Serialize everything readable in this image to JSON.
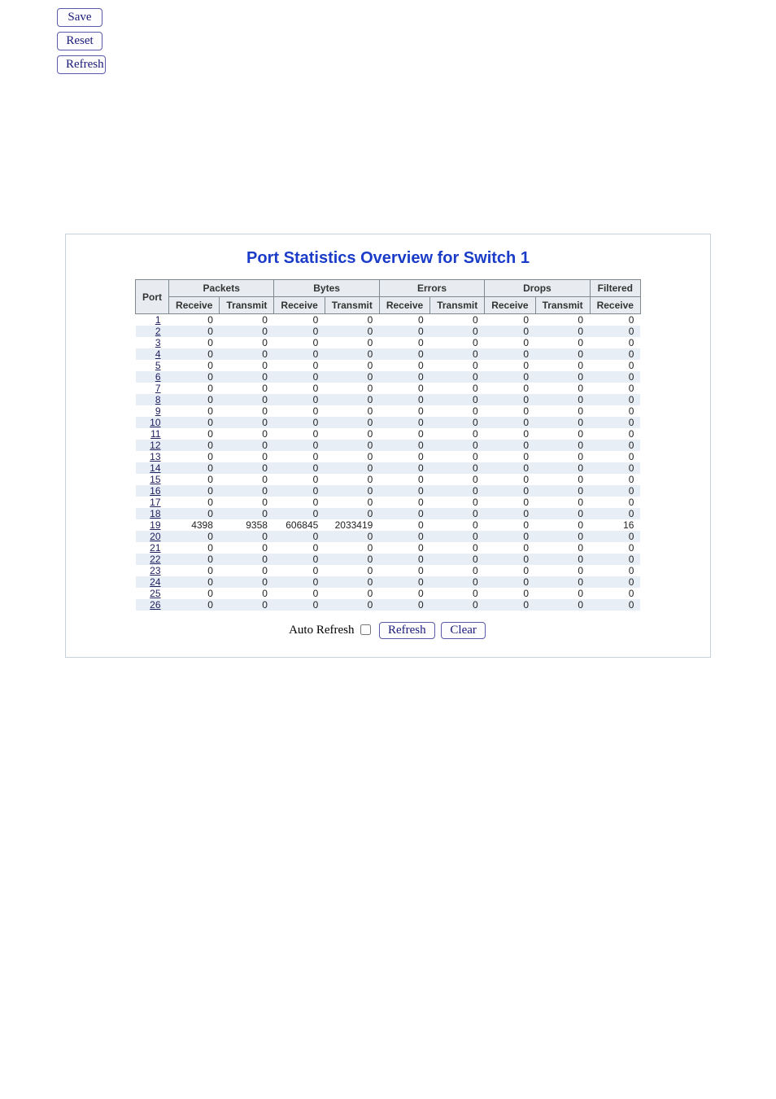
{
  "top_buttons": {
    "save": "Save",
    "reset": "Reset",
    "refresh": "Refresh"
  },
  "panel": {
    "title": "Port Statistics Overview for Switch 1"
  },
  "headers": {
    "port": "Port",
    "groups": [
      "Packets",
      "Bytes",
      "Errors",
      "Drops",
      "Filtered"
    ],
    "sub_rx": "Receive",
    "sub_tx": "Transmit"
  },
  "rows": [
    {
      "port": "1",
      "pkts_rx": "0",
      "pkts_tx": "0",
      "bytes_rx": "0",
      "bytes_tx": "0",
      "err_rx": "0",
      "err_tx": "0",
      "drop_rx": "0",
      "drop_tx": "0",
      "filt_rx": "0"
    },
    {
      "port": "2",
      "pkts_rx": "0",
      "pkts_tx": "0",
      "bytes_rx": "0",
      "bytes_tx": "0",
      "err_rx": "0",
      "err_tx": "0",
      "drop_rx": "0",
      "drop_tx": "0",
      "filt_rx": "0"
    },
    {
      "port": "3",
      "pkts_rx": "0",
      "pkts_tx": "0",
      "bytes_rx": "0",
      "bytes_tx": "0",
      "err_rx": "0",
      "err_tx": "0",
      "drop_rx": "0",
      "drop_tx": "0",
      "filt_rx": "0"
    },
    {
      "port": "4",
      "pkts_rx": "0",
      "pkts_tx": "0",
      "bytes_rx": "0",
      "bytes_tx": "0",
      "err_rx": "0",
      "err_tx": "0",
      "drop_rx": "0",
      "drop_tx": "0",
      "filt_rx": "0"
    },
    {
      "port": "5",
      "pkts_rx": "0",
      "pkts_tx": "0",
      "bytes_rx": "0",
      "bytes_tx": "0",
      "err_rx": "0",
      "err_tx": "0",
      "drop_rx": "0",
      "drop_tx": "0",
      "filt_rx": "0"
    },
    {
      "port": "6",
      "pkts_rx": "0",
      "pkts_tx": "0",
      "bytes_rx": "0",
      "bytes_tx": "0",
      "err_rx": "0",
      "err_tx": "0",
      "drop_rx": "0",
      "drop_tx": "0",
      "filt_rx": "0"
    },
    {
      "port": "7",
      "pkts_rx": "0",
      "pkts_tx": "0",
      "bytes_rx": "0",
      "bytes_tx": "0",
      "err_rx": "0",
      "err_tx": "0",
      "drop_rx": "0",
      "drop_tx": "0",
      "filt_rx": "0"
    },
    {
      "port": "8",
      "pkts_rx": "0",
      "pkts_tx": "0",
      "bytes_rx": "0",
      "bytes_tx": "0",
      "err_rx": "0",
      "err_tx": "0",
      "drop_rx": "0",
      "drop_tx": "0",
      "filt_rx": "0"
    },
    {
      "port": "9",
      "pkts_rx": "0",
      "pkts_tx": "0",
      "bytes_rx": "0",
      "bytes_tx": "0",
      "err_rx": "0",
      "err_tx": "0",
      "drop_rx": "0",
      "drop_tx": "0",
      "filt_rx": "0"
    },
    {
      "port": "10",
      "pkts_rx": "0",
      "pkts_tx": "0",
      "bytes_rx": "0",
      "bytes_tx": "0",
      "err_rx": "0",
      "err_tx": "0",
      "drop_rx": "0",
      "drop_tx": "0",
      "filt_rx": "0"
    },
    {
      "port": "11",
      "pkts_rx": "0",
      "pkts_tx": "0",
      "bytes_rx": "0",
      "bytes_tx": "0",
      "err_rx": "0",
      "err_tx": "0",
      "drop_rx": "0",
      "drop_tx": "0",
      "filt_rx": "0"
    },
    {
      "port": "12",
      "pkts_rx": "0",
      "pkts_tx": "0",
      "bytes_rx": "0",
      "bytes_tx": "0",
      "err_rx": "0",
      "err_tx": "0",
      "drop_rx": "0",
      "drop_tx": "0",
      "filt_rx": "0"
    },
    {
      "port": "13",
      "pkts_rx": "0",
      "pkts_tx": "0",
      "bytes_rx": "0",
      "bytes_tx": "0",
      "err_rx": "0",
      "err_tx": "0",
      "drop_rx": "0",
      "drop_tx": "0",
      "filt_rx": "0"
    },
    {
      "port": "14",
      "pkts_rx": "0",
      "pkts_tx": "0",
      "bytes_rx": "0",
      "bytes_tx": "0",
      "err_rx": "0",
      "err_tx": "0",
      "drop_rx": "0",
      "drop_tx": "0",
      "filt_rx": "0"
    },
    {
      "port": "15",
      "pkts_rx": "0",
      "pkts_tx": "0",
      "bytes_rx": "0",
      "bytes_tx": "0",
      "err_rx": "0",
      "err_tx": "0",
      "drop_rx": "0",
      "drop_tx": "0",
      "filt_rx": "0"
    },
    {
      "port": "16",
      "pkts_rx": "0",
      "pkts_tx": "0",
      "bytes_rx": "0",
      "bytes_tx": "0",
      "err_rx": "0",
      "err_tx": "0",
      "drop_rx": "0",
      "drop_tx": "0",
      "filt_rx": "0"
    },
    {
      "port": "17",
      "pkts_rx": "0",
      "pkts_tx": "0",
      "bytes_rx": "0",
      "bytes_tx": "0",
      "err_rx": "0",
      "err_tx": "0",
      "drop_rx": "0",
      "drop_tx": "0",
      "filt_rx": "0"
    },
    {
      "port": "18",
      "pkts_rx": "0",
      "pkts_tx": "0",
      "bytes_rx": "0",
      "bytes_tx": "0",
      "err_rx": "0",
      "err_tx": "0",
      "drop_rx": "0",
      "drop_tx": "0",
      "filt_rx": "0"
    },
    {
      "port": "19",
      "pkts_rx": "4398",
      "pkts_tx": "9358",
      "bytes_rx": "606845",
      "bytes_tx": "2033419",
      "err_rx": "0",
      "err_tx": "0",
      "drop_rx": "0",
      "drop_tx": "0",
      "filt_rx": "16"
    },
    {
      "port": "20",
      "pkts_rx": "0",
      "pkts_tx": "0",
      "bytes_rx": "0",
      "bytes_tx": "0",
      "err_rx": "0",
      "err_tx": "0",
      "drop_rx": "0",
      "drop_tx": "0",
      "filt_rx": "0"
    },
    {
      "port": "21",
      "pkts_rx": "0",
      "pkts_tx": "0",
      "bytes_rx": "0",
      "bytes_tx": "0",
      "err_rx": "0",
      "err_tx": "0",
      "drop_rx": "0",
      "drop_tx": "0",
      "filt_rx": "0"
    },
    {
      "port": "22",
      "pkts_rx": "0",
      "pkts_tx": "0",
      "bytes_rx": "0",
      "bytes_tx": "0",
      "err_rx": "0",
      "err_tx": "0",
      "drop_rx": "0",
      "drop_tx": "0",
      "filt_rx": "0"
    },
    {
      "port": "23",
      "pkts_rx": "0",
      "pkts_tx": "0",
      "bytes_rx": "0",
      "bytes_tx": "0",
      "err_rx": "0",
      "err_tx": "0",
      "drop_rx": "0",
      "drop_tx": "0",
      "filt_rx": "0"
    },
    {
      "port": "24",
      "pkts_rx": "0",
      "pkts_tx": "0",
      "bytes_rx": "0",
      "bytes_tx": "0",
      "err_rx": "0",
      "err_tx": "0",
      "drop_rx": "0",
      "drop_tx": "0",
      "filt_rx": "0"
    },
    {
      "port": "25",
      "pkts_rx": "0",
      "pkts_tx": "0",
      "bytes_rx": "0",
      "bytes_tx": "0",
      "err_rx": "0",
      "err_tx": "0",
      "drop_rx": "0",
      "drop_tx": "0",
      "filt_rx": "0"
    },
    {
      "port": "26",
      "pkts_rx": "0",
      "pkts_tx": "0",
      "bytes_rx": "0",
      "bytes_tx": "0",
      "err_rx": "0",
      "err_tx": "0",
      "drop_rx": "0",
      "drop_tx": "0",
      "filt_rx": "0"
    }
  ],
  "footer": {
    "auto_refresh": "Auto Refresh",
    "refresh": "Refresh",
    "clear": "Clear"
  }
}
